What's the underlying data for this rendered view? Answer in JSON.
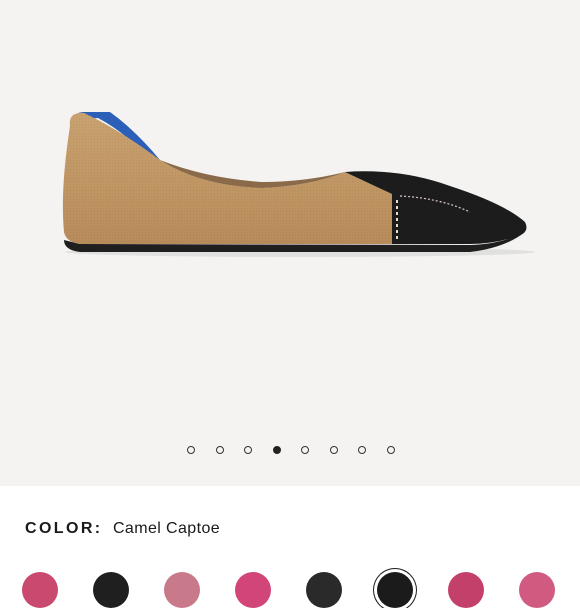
{
  "gallery": {
    "image_alt": "Camel Captoe pointed flat",
    "dot_count": 8,
    "active_index": 3
  },
  "product": {
    "color_label": "COLOR:",
    "color_value": "Camel Captoe"
  },
  "swatches": [
    {
      "name": "swatch-1",
      "color": "#c94a6e"
    },
    {
      "name": "swatch-2",
      "color": "#1f1f1f"
    },
    {
      "name": "swatch-3",
      "color": "#c97a8a"
    },
    {
      "name": "swatch-4",
      "color": "#d24578"
    },
    {
      "name": "swatch-5",
      "color": "#2a2a2a"
    },
    {
      "name": "swatch-6-selected",
      "color": "#1b1b1b"
    },
    {
      "name": "swatch-7",
      "color": "#c2406a"
    },
    {
      "name": "swatch-8",
      "color": "#d05a80"
    }
  ],
  "colors": {
    "hero_bg": "#f4f3f1",
    "camel": "#c39a68",
    "black_cap": "#1c1c1c",
    "heel_blue": "#2b5fb8"
  }
}
